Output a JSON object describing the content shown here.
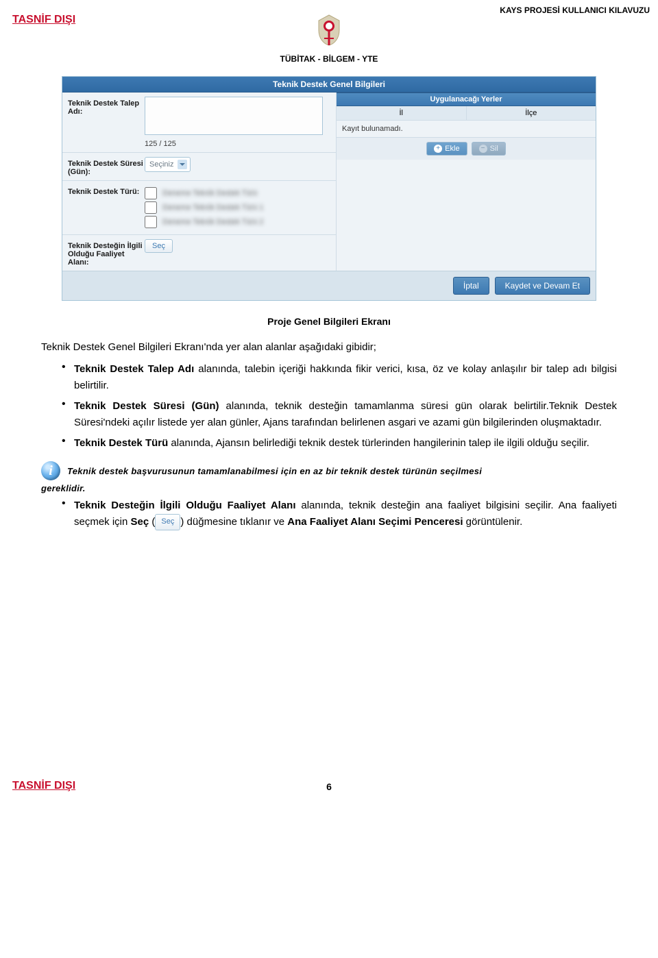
{
  "header": {
    "classif": "TASNİF DIŞI",
    "right_title": "KAYS PROJESİ KULLANICI KILAVUZU",
    "org": "TÜBİTAK - BİLGEM - YTE"
  },
  "ui": {
    "title": "Teknik Destek Genel Bilgileri",
    "labels": {
      "talep_adi": "Teknik Destek Talep Adı:",
      "sure": "Teknik Destek Süresi (Gün):",
      "tur": "Teknik Destek Türü:",
      "faaliyet": "Teknik Desteğin İlgili Olduğu Faaliyet Alanı:"
    },
    "counter": "125 / 125",
    "select_placeholder": "Seçiniz",
    "sec_btn": "Seç",
    "checkbox_placeholders": [
      "Deneme Teknik Destek Türü",
      "Deneme Teknik Destek Türü 1",
      "Deneme Teknik Destek Türü 2"
    ],
    "right": {
      "title": "Uygulanacağı Yerler",
      "col_il": "İl",
      "col_ilce": "İlçe",
      "empty": "Kayıt bulunamadı.",
      "add": "Ekle",
      "del": "Sil"
    },
    "footer": {
      "cancel": "İptal",
      "save": "Kaydet ve Devam Et"
    }
  },
  "doc": {
    "caption": "Proje Genel Bilgileri Ekranı",
    "intro": "Teknik Destek Genel Bilgileri Ekranı'nda yer alan alanlar aşağıdaki gibidir;",
    "b1_lead": "Teknik Destek Talep Adı",
    "b1_rest": " alanında, talebin içeriği hakkında fikir verici, kısa, öz ve kolay anlaşılır bir talep adı bilgisi belirtilir.",
    "b2_lead": "Teknik Destek Süresi (Gün)",
    "b2_rest": " alanında, teknik desteğin tamamlanma süresi gün olarak belirtilir.Teknik Destek Süresi'ndeki açılır listede yer alan günler, Ajans tarafından belirlenen asgari ve azami gün bilgilerinden oluşmaktadır.",
    "b3_lead": "Teknik Destek Türü",
    "b3_rest": " alanında, Ajansın belirlediği teknik destek türlerinden hangilerinin talep ile ilgili olduğu seçilir.",
    "info_line": "Teknik destek başvurusunun tamamlanabilmesi için en az bir teknik destek türünün seçilmesi",
    "info_line2": "gereklidir.",
    "b4_lead": "Teknik Desteğin İlgili Olduğu Faaliyet Alanı",
    "b4_rest_a": " alanında, teknik desteğin ana faaliyet bilgisini seçilir. Ana faaliyeti seçmek için ",
    "b4_sec_word": "Seç",
    "b4_rest_b": " (",
    "b4_sec_inline": "Seç",
    "b4_rest_c": ") düğmesine tıklanır ve ",
    "b4_rest_d": "Ana Faaliyet Alanı Seçimi Penceresi",
    "b4_rest_e": " görüntülenir."
  },
  "footer": {
    "classif": "TASNİF DIŞI",
    "page": "6"
  }
}
